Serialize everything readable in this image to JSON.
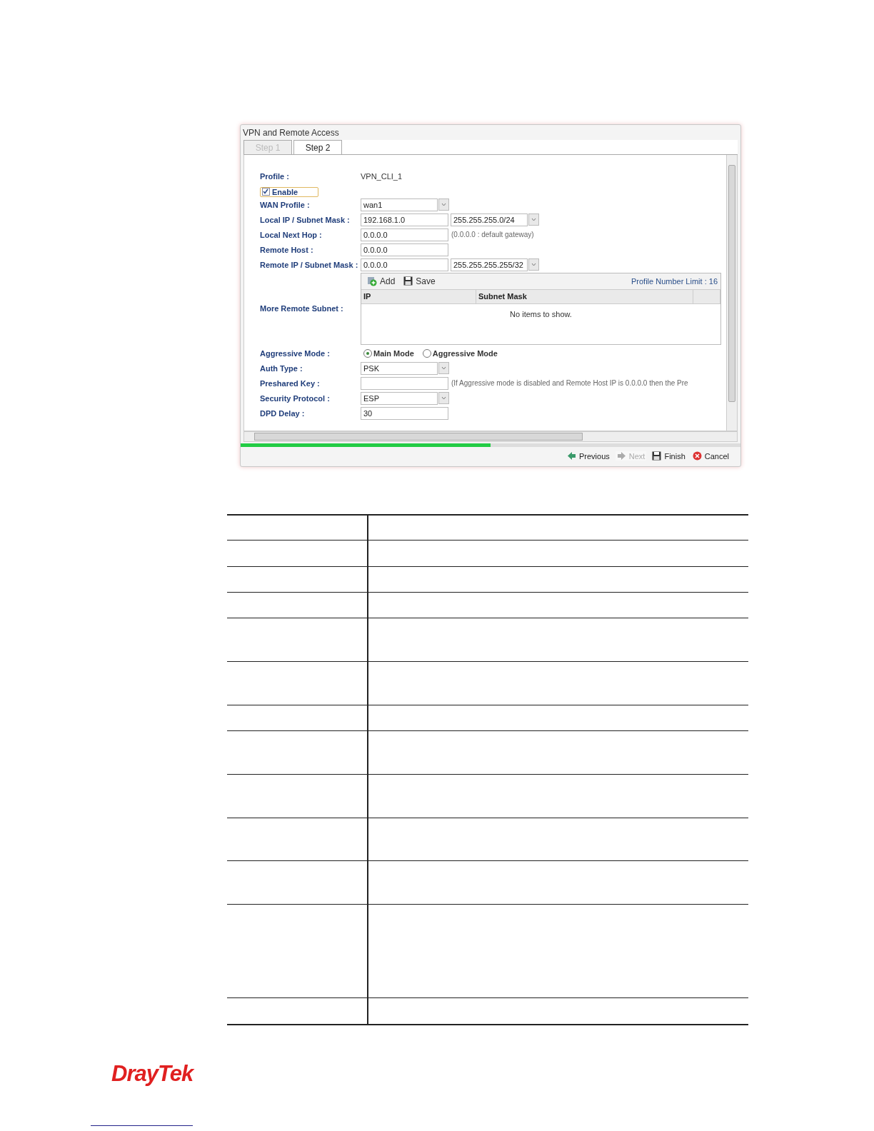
{
  "window": {
    "title": "VPN and Remote Access"
  },
  "tabs": [
    {
      "label": "Step 1",
      "selected": false
    },
    {
      "label": "Step 2",
      "selected": true
    }
  ],
  "profile": {
    "label": "Profile :",
    "value": "VPN_CLI_1"
  },
  "enable": {
    "label": "Enable",
    "checked": true
  },
  "fields": [
    {
      "kind": "select",
      "label": "WAN Profile :",
      "value": "wan1"
    },
    {
      "kind": "input-select",
      "label": "Local IP / Subnet Mask :",
      "value": "192.168.1.0",
      "option": "255.255.255.0/24"
    },
    {
      "kind": "input",
      "label": "Local Next Hop :",
      "value": "0.0.0.0",
      "hint": "(0.0.0.0 : default gateway)"
    },
    {
      "kind": "input",
      "label": "Remote Host :",
      "value": "0.0.0.0"
    },
    {
      "kind": "input-select",
      "label": "Remote IP / Subnet Mask :",
      "value": "0.0.0.0",
      "option": "255.255.255.255/32"
    },
    {
      "kind": "grid",
      "label": "More Remote Subnet :",
      "buttons": [
        "Add",
        "Save"
      ],
      "limit": "Profile Number Limit : 16",
      "columns": [
        "IP",
        "Subnet Mask"
      ],
      "empty": "No items to show."
    },
    {
      "kind": "radio",
      "label": "Aggressive Mode :",
      "options": [
        {
          "label": "Main Mode",
          "selected": true
        },
        {
          "label": "Aggressive Mode",
          "selected": false
        }
      ]
    },
    {
      "kind": "select",
      "label": "Auth Type :",
      "value": "PSK"
    },
    {
      "kind": "input",
      "label": "Preshared Key :",
      "hint": "(If Aggressive mode is disabled and Remote Host IP is 0.0.0.0 then the Pre"
    },
    {
      "kind": "select",
      "label": "Security Protocol :",
      "value": "ESP"
    },
    {
      "kind": "input",
      "label": "DPD Delay :",
      "value": "30"
    }
  ],
  "progress": {
    "level": 0.5
  },
  "footer_buttons": [
    {
      "label": "Previous",
      "kind": "previous",
      "disabled": false
    },
    {
      "label": "Next",
      "kind": "next",
      "disabled": true
    },
    {
      "label": "Finish",
      "kind": "finish",
      "disabled": false
    },
    {
      "label": "Cancel",
      "kind": "cancel",
      "disabled": false
    }
  ],
  "logo": "DrayTek"
}
